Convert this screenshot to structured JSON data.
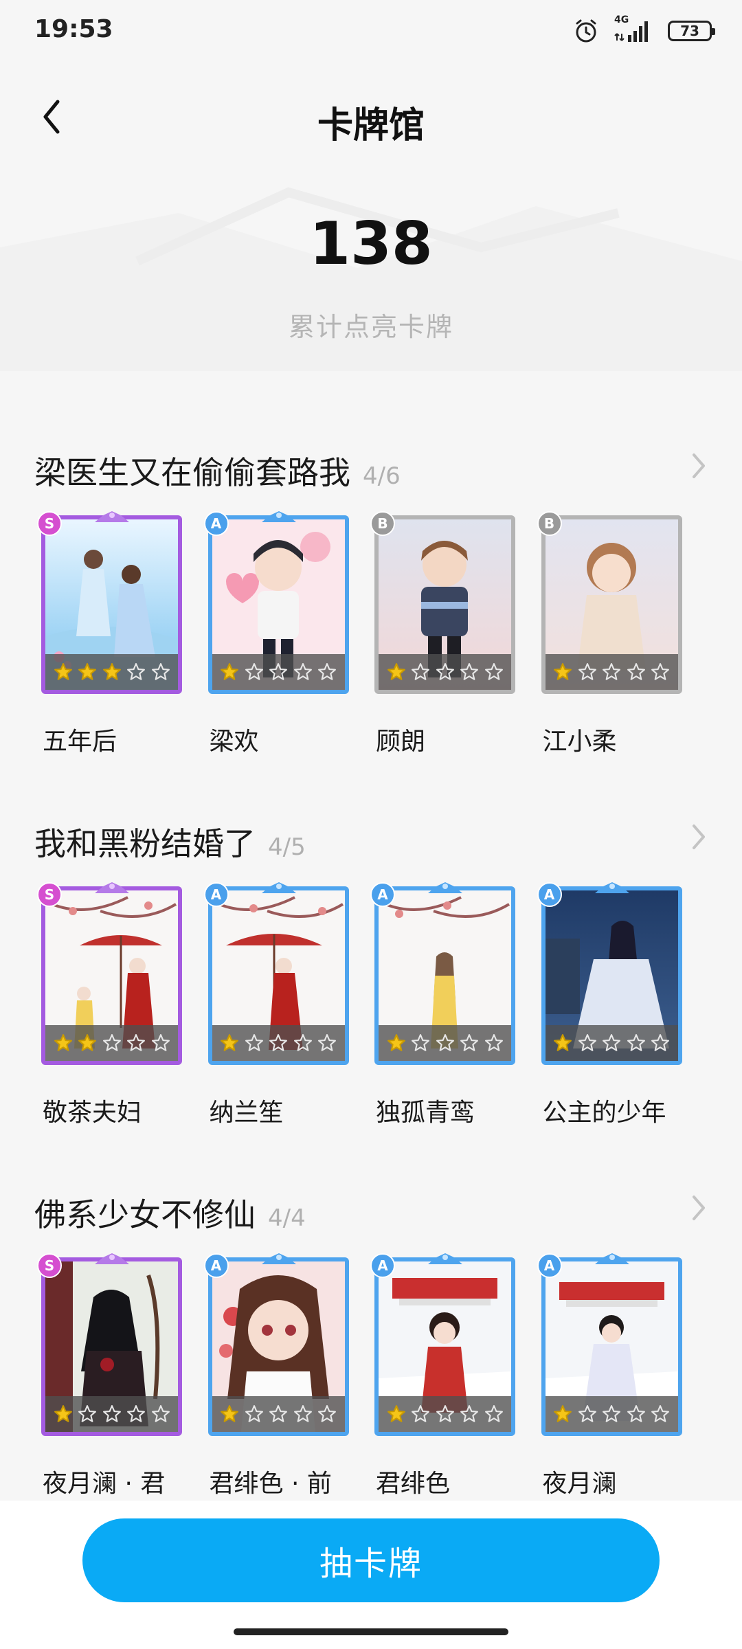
{
  "status_bar": {
    "time": "19:53",
    "network": "4G",
    "battery": "73",
    "icons": [
      "alarm-icon",
      "signal-icon",
      "battery-icon"
    ]
  },
  "header": {
    "title": "卡牌馆",
    "back_icon": "chevron-left-icon"
  },
  "hero": {
    "count": "138",
    "caption": "累计点亮卡牌"
  },
  "sections": [
    {
      "title": "梁医生又在偷偷套路我",
      "progress": "4/6",
      "cards": [
        {
          "name": "五年后",
          "rank": "S",
          "stars": 3
        },
        {
          "name": "梁欢",
          "rank": "A",
          "stars": 1
        },
        {
          "name": "顾朗",
          "rank": "B",
          "stars": 1
        },
        {
          "name": "江小柔",
          "rank": "B",
          "stars": 1
        }
      ]
    },
    {
      "title": "我和黑粉结婚了",
      "progress": "4/5",
      "cards": [
        {
          "name": "敬茶夫妇",
          "rank": "S",
          "stars": 2
        },
        {
          "name": "纳兰笙",
          "rank": "A",
          "stars": 1
        },
        {
          "name": "独孤青鸾",
          "rank": "A",
          "stars": 1
        },
        {
          "name": "公主的少年",
          "rank": "A",
          "stars": 1
        }
      ]
    },
    {
      "title": "佛系少女不修仙",
      "progress": "4/4",
      "cards": [
        {
          "name": "夜月澜 · 君",
          "rank": "S",
          "stars": 1
        },
        {
          "name": "君绯色 · 前",
          "rank": "A",
          "stars": 1
        },
        {
          "name": "君绯色",
          "rank": "A",
          "stars": 1
        },
        {
          "name": "夜月澜",
          "rank": "A",
          "stars": 1
        }
      ]
    }
  ],
  "bottom": {
    "draw_label": "抽卡牌"
  },
  "colors": {
    "accent": "#0aaaf5",
    "rank_s": "#a45be0",
    "rank_a": "#4ea4ee",
    "rank_b": "#b4b4b4",
    "star_on": "#f5c518"
  }
}
